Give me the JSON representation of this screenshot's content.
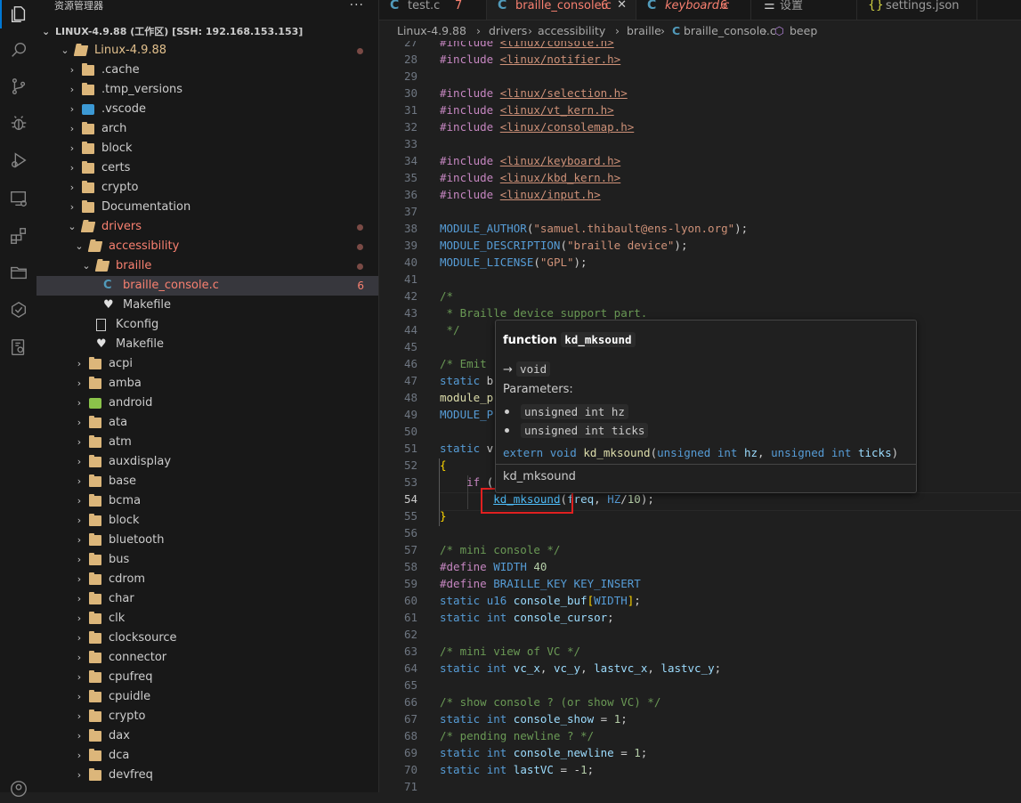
{
  "sidebar": {
    "title": "资源管理器",
    "more": "···",
    "root": "LINUX-4.9.88 (工作区) [SSH: 192.168.153.153]",
    "tree": [
      {
        "label": "Linux-4.9.88",
        "expanded": true,
        "level": 0,
        "type": "folder",
        "state": "mod",
        "dot": true
      },
      {
        "label": ".cache",
        "level": 1,
        "type": "folder"
      },
      {
        "label": ".tmp_versions",
        "level": 1,
        "type": "folder"
      },
      {
        "label": ".vscode",
        "level": 1,
        "type": "vscode"
      },
      {
        "label": "arch",
        "level": 1,
        "type": "folder"
      },
      {
        "label": "block",
        "level": 1,
        "type": "folder"
      },
      {
        "label": "certs",
        "level": 1,
        "type": "folder"
      },
      {
        "label": "crypto",
        "level": 1,
        "type": "folder"
      },
      {
        "label": "Documentation",
        "level": 1,
        "type": "folder"
      },
      {
        "label": "drivers",
        "expanded": true,
        "level": 1,
        "type": "folder",
        "state": "err",
        "dot": true
      },
      {
        "label": "accessibility",
        "expanded": true,
        "level": 2,
        "type": "folder",
        "state": "err",
        "dot": true
      },
      {
        "label": "braille",
        "expanded": true,
        "level": 3,
        "type": "folder",
        "state": "err",
        "dot": true
      },
      {
        "label": "braille_console.c",
        "level": 4,
        "type": "c",
        "state": "err",
        "count": "6",
        "selected": true
      },
      {
        "label": "Makefile",
        "level": 4,
        "type": "make"
      },
      {
        "label": "Kconfig",
        "level": 3,
        "type": "file"
      },
      {
        "label": "Makefile",
        "level": 3,
        "type": "make"
      },
      {
        "label": "acpi",
        "level": 2,
        "type": "folder"
      },
      {
        "label": "amba",
        "level": 2,
        "type": "folder"
      },
      {
        "label": "android",
        "level": 2,
        "type": "android"
      },
      {
        "label": "ata",
        "level": 2,
        "type": "folder"
      },
      {
        "label": "atm",
        "level": 2,
        "type": "folder"
      },
      {
        "label": "auxdisplay",
        "level": 2,
        "type": "folder"
      },
      {
        "label": "base",
        "level": 2,
        "type": "folder"
      },
      {
        "label": "bcma",
        "level": 2,
        "type": "folder"
      },
      {
        "label": "block",
        "level": 2,
        "type": "folder"
      },
      {
        "label": "bluetooth",
        "level": 2,
        "type": "folder"
      },
      {
        "label": "bus",
        "level": 2,
        "type": "folder"
      },
      {
        "label": "cdrom",
        "level": 2,
        "type": "folder"
      },
      {
        "label": "char",
        "level": 2,
        "type": "folder"
      },
      {
        "label": "clk",
        "level": 2,
        "type": "folder"
      },
      {
        "label": "clocksource",
        "level": 2,
        "type": "folder"
      },
      {
        "label": "connector",
        "level": 2,
        "type": "folder"
      },
      {
        "label": "cpufreq",
        "level": 2,
        "type": "folder"
      },
      {
        "label": "cpuidle",
        "level": 2,
        "type": "folder"
      },
      {
        "label": "crypto",
        "level": 2,
        "type": "folder"
      },
      {
        "label": "dax",
        "level": 2,
        "type": "folder"
      },
      {
        "label": "dca",
        "level": 2,
        "type": "folder"
      },
      {
        "label": "devfreq",
        "level": 2,
        "type": "folder"
      }
    ]
  },
  "tabs": [
    {
      "name": "test.c",
      "count": "7",
      "icon": "c"
    },
    {
      "name": "braille_console.c",
      "count": "6",
      "icon": "c",
      "active": true
    },
    {
      "name": "keyboard.c",
      "count": "6",
      "icon": "c"
    },
    {
      "name": "设置",
      "icon": "settings"
    },
    {
      "name": "settings.json",
      "icon": "json"
    }
  ],
  "breadcrumb": {
    "items": [
      "Linux-4.9.88",
      "drivers",
      "accessibility",
      "braille",
      "braille_console.c",
      "beep"
    ]
  },
  "editor": {
    "current_line": "54",
    "lines": [
      {
        "n": "27",
        "html": "<span class='pp'>#include</span> <span class='inc'>&lt;linux/console.h&gt;</span>"
      },
      {
        "n": "28",
        "html": "<span class='pp'>#include</span> <span class='inc'>&lt;linux/notifier.h&gt;</span>"
      },
      {
        "n": "29",
        "html": ""
      },
      {
        "n": "30",
        "html": "<span class='pp'>#include</span> <span class='inc'>&lt;linux/selection.h&gt;</span>"
      },
      {
        "n": "31",
        "html": "<span class='pp'>#include</span> <span class='inc'>&lt;linux/vt_kern.h&gt;</span>"
      },
      {
        "n": "32",
        "html": "<span class='pp'>#include</span> <span class='inc'>&lt;linux/consolemap.h&gt;</span>"
      },
      {
        "n": "33",
        "html": ""
      },
      {
        "n": "34",
        "html": "<span class='pp'>#include</span> <span class='inc'>&lt;linux/keyboard.h&gt;</span>"
      },
      {
        "n": "35",
        "html": "<span class='pp'>#include</span> <span class='inc'>&lt;linux/kbd_kern.h&gt;</span>"
      },
      {
        "n": "36",
        "html": "<span class='pp'>#include</span> <span class='inc'>&lt;linux/input.h&gt;</span>"
      },
      {
        "n": "37",
        "html": ""
      },
      {
        "n": "38",
        "html": "<span class='mac'>MODULE_AUTHOR</span>(<span class='str'>\"samuel.thibault@ens-lyon.org\"</span>);"
      },
      {
        "n": "39",
        "html": "<span class='mac'>MODULE_DESCRIPTION</span>(<span class='str'>\"braille device\"</span>);"
      },
      {
        "n": "40",
        "html": "<span class='mac'>MODULE_LICENSE</span>(<span class='str'>\"GPL\"</span>);"
      },
      {
        "n": "41",
        "html": ""
      },
      {
        "n": "42",
        "html": "<span class='cm'>/*</span>"
      },
      {
        "n": "43",
        "html": "<span class='cm'> * Braille device support part.</span>"
      },
      {
        "n": "44",
        "html": "<span class='cm'> */</span>"
      },
      {
        "n": "45",
        "html": ""
      },
      {
        "n": "46",
        "html": "<span class='cm'>/* Emit</span>"
      },
      {
        "n": "47",
        "html": "<span class='kw'>static</span> b"
      },
      {
        "n": "48",
        "html": "<span class='fn'>module_p</span>"
      },
      {
        "n": "49",
        "html": "<span class='mac'>MODULE_P</span>"
      },
      {
        "n": "50",
        "html": ""
      },
      {
        "n": "51",
        "html": "<span class='kw'>static</span> v"
      },
      {
        "n": "52",
        "html": "<span class='br'>{</span>"
      },
      {
        "n": "53",
        "html": "    <span class='pp'>if</span> ("
      },
      {
        "n": "54",
        "html": "        <span class='link'>kd_mksound</span>(<span class='var'>freq</span>, <span class='mac'>HZ</span>/<span class='num'>10</span>);"
      },
      {
        "n": "55",
        "html": "<span class='br'>}</span>"
      },
      {
        "n": "56",
        "html": ""
      },
      {
        "n": "57",
        "html": "<span class='cm'>/* mini console */</span>"
      },
      {
        "n": "58",
        "html": "<span class='pp'>#define</span> <span class='mac'>WIDTH</span> <span class='num'>40</span>"
      },
      {
        "n": "59",
        "html": "<span class='pp'>#define</span> <span class='mac'>BRAILLE_KEY</span> <span class='mac'>KEY_INSERT</span>"
      },
      {
        "n": "60",
        "html": "<span class='kw'>static</span> <span class='kw'>u16</span> <span class='var'>console_buf</span><span class='br'>[</span><span class='mac'>WIDTH</span><span class='br'>]</span>;"
      },
      {
        "n": "61",
        "html": "<span class='kw'>static</span> <span class='kw'>int</span> <span class='var'>console_cursor</span>;"
      },
      {
        "n": "62",
        "html": ""
      },
      {
        "n": "63",
        "html": "<span class='cm'>/* mini view of VC */</span>"
      },
      {
        "n": "64",
        "html": "<span class='kw'>static</span> <span class='kw'>int</span> <span class='var'>vc_x</span>, <span class='var'>vc_y</span>, <span class='var'>lastvc_x</span>, <span class='var'>lastvc_y</span>;"
      },
      {
        "n": "65",
        "html": ""
      },
      {
        "n": "66",
        "html": "<span class='cm'>/* show console ? (or show VC) */</span>"
      },
      {
        "n": "67",
        "html": "<span class='kw'>static</span> <span class='kw'>int</span> <span class='var'>console_show</span> = <span class='num'>1</span>;"
      },
      {
        "n": "68",
        "html": "<span class='cm'>/* pending newline ? */</span>"
      },
      {
        "n": "69",
        "html": "<span class='kw'>static</span> <span class='kw'>int</span> <span class='var'>console_newline</span> = <span class='num'>1</span>;"
      },
      {
        "n": "70",
        "html": "<span class='kw'>static</span> <span class='kw'>int</span> <span class='var'>lastVC</span> = -<span class='num'>1</span>;"
      },
      {
        "n": "71",
        "html": ""
      }
    ]
  },
  "hover": {
    "kind": "function",
    "name": "kd_mksound",
    "arrow": "→",
    "returns": "void",
    "params_label": "Parameters:",
    "params": [
      "unsigned int hz",
      "unsigned int ticks"
    ],
    "signature_html": "<span class='kw'>extern</span> <span class='kw'>void</span> <span class='fn'>kd_mksound</span>(<span class='kw'>unsigned</span> <span class='kw'>int</span> <span class='var'>hz</span>, <span class='kw'>unsigned</span> <span class='kw'>int</span> <span class='var'>ticks</span>)",
    "footer": "kd_mksound"
  },
  "colors": {
    "accent": "#0078d4",
    "error": "#f88070",
    "modified": "#e2c08d",
    "highlight": "#e02020"
  }
}
